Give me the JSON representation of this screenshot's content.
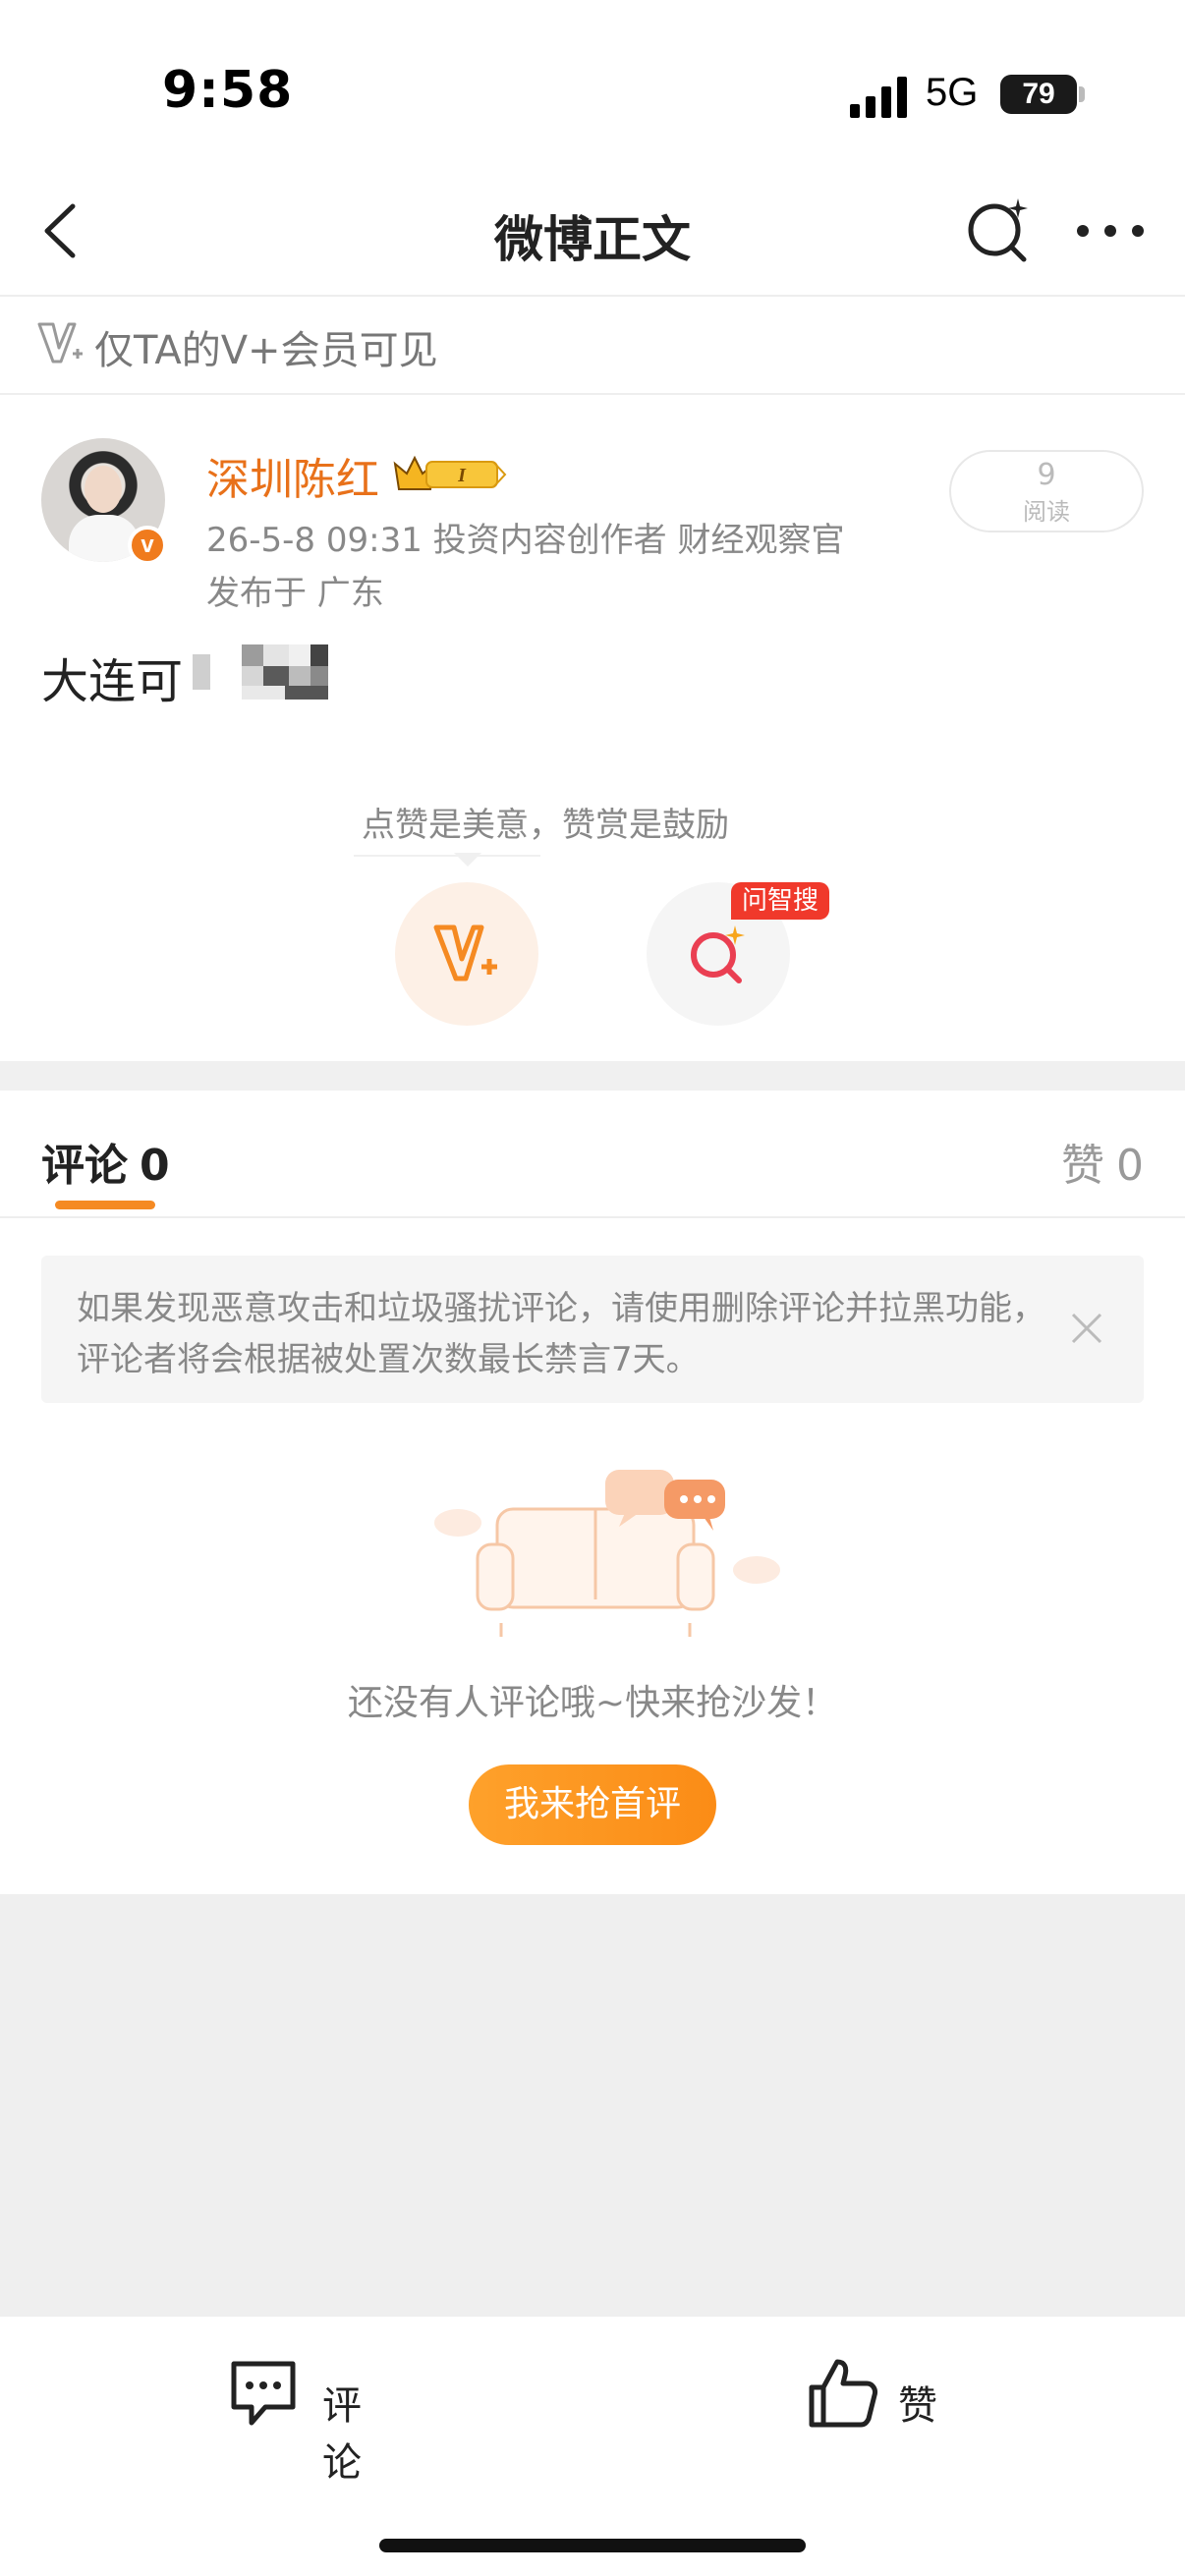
{
  "status_bar": {
    "time": "9:58",
    "network": "5G",
    "battery": "79"
  },
  "header": {
    "title": "微博正文",
    "icons": [
      "back-icon",
      "search-icon",
      "more-icon"
    ]
  },
  "visibility": {
    "text": "仅TA的V+会员可见"
  },
  "post": {
    "author": "深圳陈红",
    "meta": "26-5-8 09:31  投资内容创作者 财经观察官",
    "location": "发布于 广东",
    "read_count": "9",
    "read_label": "阅读",
    "content": "大连可"
  },
  "actions": {
    "tip": "点赞是美意，赞赏是鼓励",
    "zhisou_tag": "问智搜"
  },
  "tabs": {
    "comment_label": "评论",
    "comment_count": "0",
    "like_label": "赞",
    "like_count": "0"
  },
  "notice": {
    "text": "如果发现恶意攻击和垃圾骚扰评论，请使用删除评论并拉黑功能，评论者将会根据被处置次数最长禁言7天。"
  },
  "empty": {
    "text": "还没有人评论哦~快来抢沙发！",
    "button": "我来抢首评"
  },
  "bottom_bar": {
    "comment": "评论",
    "like": "赞"
  },
  "colors": {
    "accent": "#f58a22",
    "username": "#e8711a",
    "tag_red": "#f0392b"
  }
}
